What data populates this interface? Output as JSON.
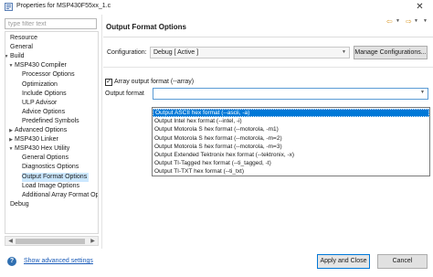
{
  "window": {
    "title": "Properties for MSP430F55xx_1.c",
    "close_glyph": "✕"
  },
  "filter": {
    "placeholder": "type filter text"
  },
  "tree": {
    "items": [
      {
        "label": "Resource",
        "twisty": ""
      },
      {
        "label": "General",
        "twisty": ""
      },
      {
        "label": "Build",
        "twisty": "▼"
      },
      {
        "label": "MSP430 Compiler",
        "twisty": "▼"
      },
      {
        "label": "Processor Options",
        "twisty": ""
      },
      {
        "label": "Optimization",
        "twisty": ""
      },
      {
        "label": "Include Options",
        "twisty": ""
      },
      {
        "label": "ULP Advisor",
        "twisty": ""
      },
      {
        "label": "Advice Options",
        "twisty": ""
      },
      {
        "label": "Predefined Symbols",
        "twisty": ""
      },
      {
        "label": "Advanced Options",
        "twisty": "▶"
      },
      {
        "label": "MSP430 Linker",
        "twisty": "▶"
      },
      {
        "label": "MSP430 Hex Utility",
        "twisty": "▼"
      },
      {
        "label": "General Options",
        "twisty": ""
      },
      {
        "label": "Diagnostics Options",
        "twisty": ""
      },
      {
        "label": "Output Format Options",
        "twisty": ""
      },
      {
        "label": "Load Image Options",
        "twisty": ""
      },
      {
        "label": "Additional Array Format Op",
        "twisty": ""
      },
      {
        "label": "Debug",
        "twisty": ""
      }
    ],
    "selected_index": 15,
    "scroll_left": "◀",
    "scroll_right": "▶"
  },
  "page": {
    "title": "Output Format Options",
    "nav_back": "⇦",
    "nav_fwd": "⇨",
    "dd_glyph": "▼"
  },
  "configuration": {
    "label": "Configuration:",
    "value": "Debug  [ Active ]",
    "manage_label": "Manage Configurations..."
  },
  "array_output": {
    "checked": "✓",
    "label": "Array output format (--array)"
  },
  "output_format": {
    "label": "Output format",
    "value": "",
    "options": [
      "Output ASCII hex format (--ascii, -a)",
      "Output Intel hex format (--intel, -i)",
      "Output Motorola S hex format (--motorola, -m1)",
      "Output Motorola S hex format (--motorola, -m=2)",
      "Output Motorola S hex format (--motorola, -m=3)",
      "Output Extended Tektronix hex format (--tektronix, -x)",
      "Output TI-Tagged hex format (--ti_tagged, -t)",
      "Output TI-TXT hex format (--ti_txt)"
    ],
    "selected_index": 0
  },
  "footer": {
    "help_glyph": "?",
    "show_advanced": "Show advanced settings",
    "apply_close": "Apply and Close",
    "cancel": "Cancel"
  },
  "colors": {
    "selection": "#0078d7",
    "tree_selection": "#cce8ff",
    "link": "#1a5bb8"
  }
}
